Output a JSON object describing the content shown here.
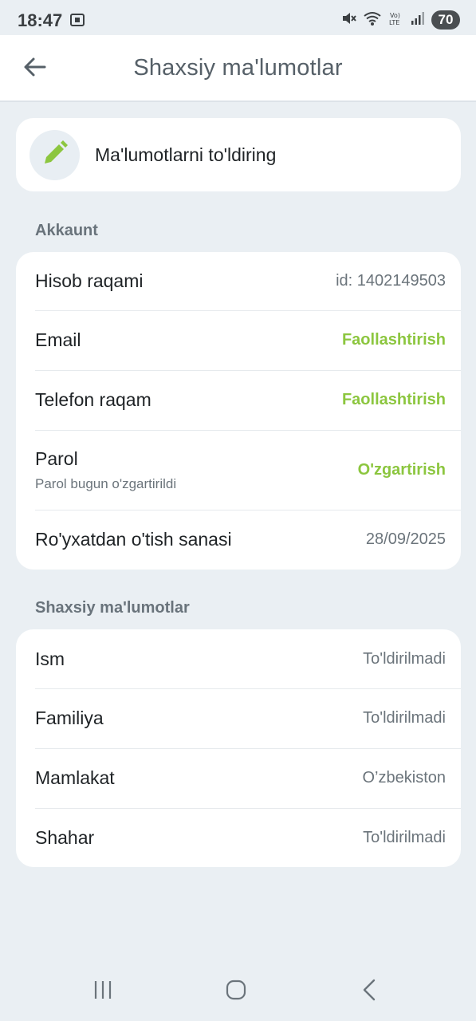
{
  "status_bar": {
    "time": "18:47",
    "battery": "70",
    "icons": [
      "screenshot-icon",
      "mute-icon",
      "wifi-icon",
      "volte-icon",
      "signal-icon"
    ]
  },
  "header": {
    "title": "Shaxsiy ma'lumotlar",
    "back_icon": "arrow-left-icon"
  },
  "fill_card": {
    "label": "Ma'lumotlarni to'ldiring",
    "icon": "pencil-icon"
  },
  "account": {
    "title": "Akkaunt",
    "rows": [
      {
        "label": "Hisob raqami",
        "value": "id: 1402149503"
      },
      {
        "label": "Email",
        "action": "Faollashtirish"
      },
      {
        "label": "Telefon raqam",
        "action": "Faollashtirish"
      },
      {
        "label": "Parol",
        "sub": "Parol bugun o'zgartirildi",
        "action": "O'zgartirish"
      },
      {
        "label": "Ro'yxatdan o'tish sanasi",
        "value": "28/09/2025"
      }
    ]
  },
  "personal": {
    "title": "Shaxsiy ma'lumotlar",
    "rows": [
      {
        "label": "Ism",
        "value": "To'ldirilmadi"
      },
      {
        "label": "Familiya",
        "value": "To'ldirilmadi"
      },
      {
        "label": "Mamlakat",
        "value": "O’zbekiston"
      },
      {
        "label": "Shahar",
        "value": "To'ldirilmadi"
      }
    ]
  },
  "nav_bar": {
    "icons": [
      "recents-icon",
      "home-icon",
      "back-icon"
    ]
  },
  "colors": {
    "accent": "#8cc63f",
    "background": "#eaeff3",
    "card": "#ffffff",
    "muted_text": "#6b747b"
  }
}
